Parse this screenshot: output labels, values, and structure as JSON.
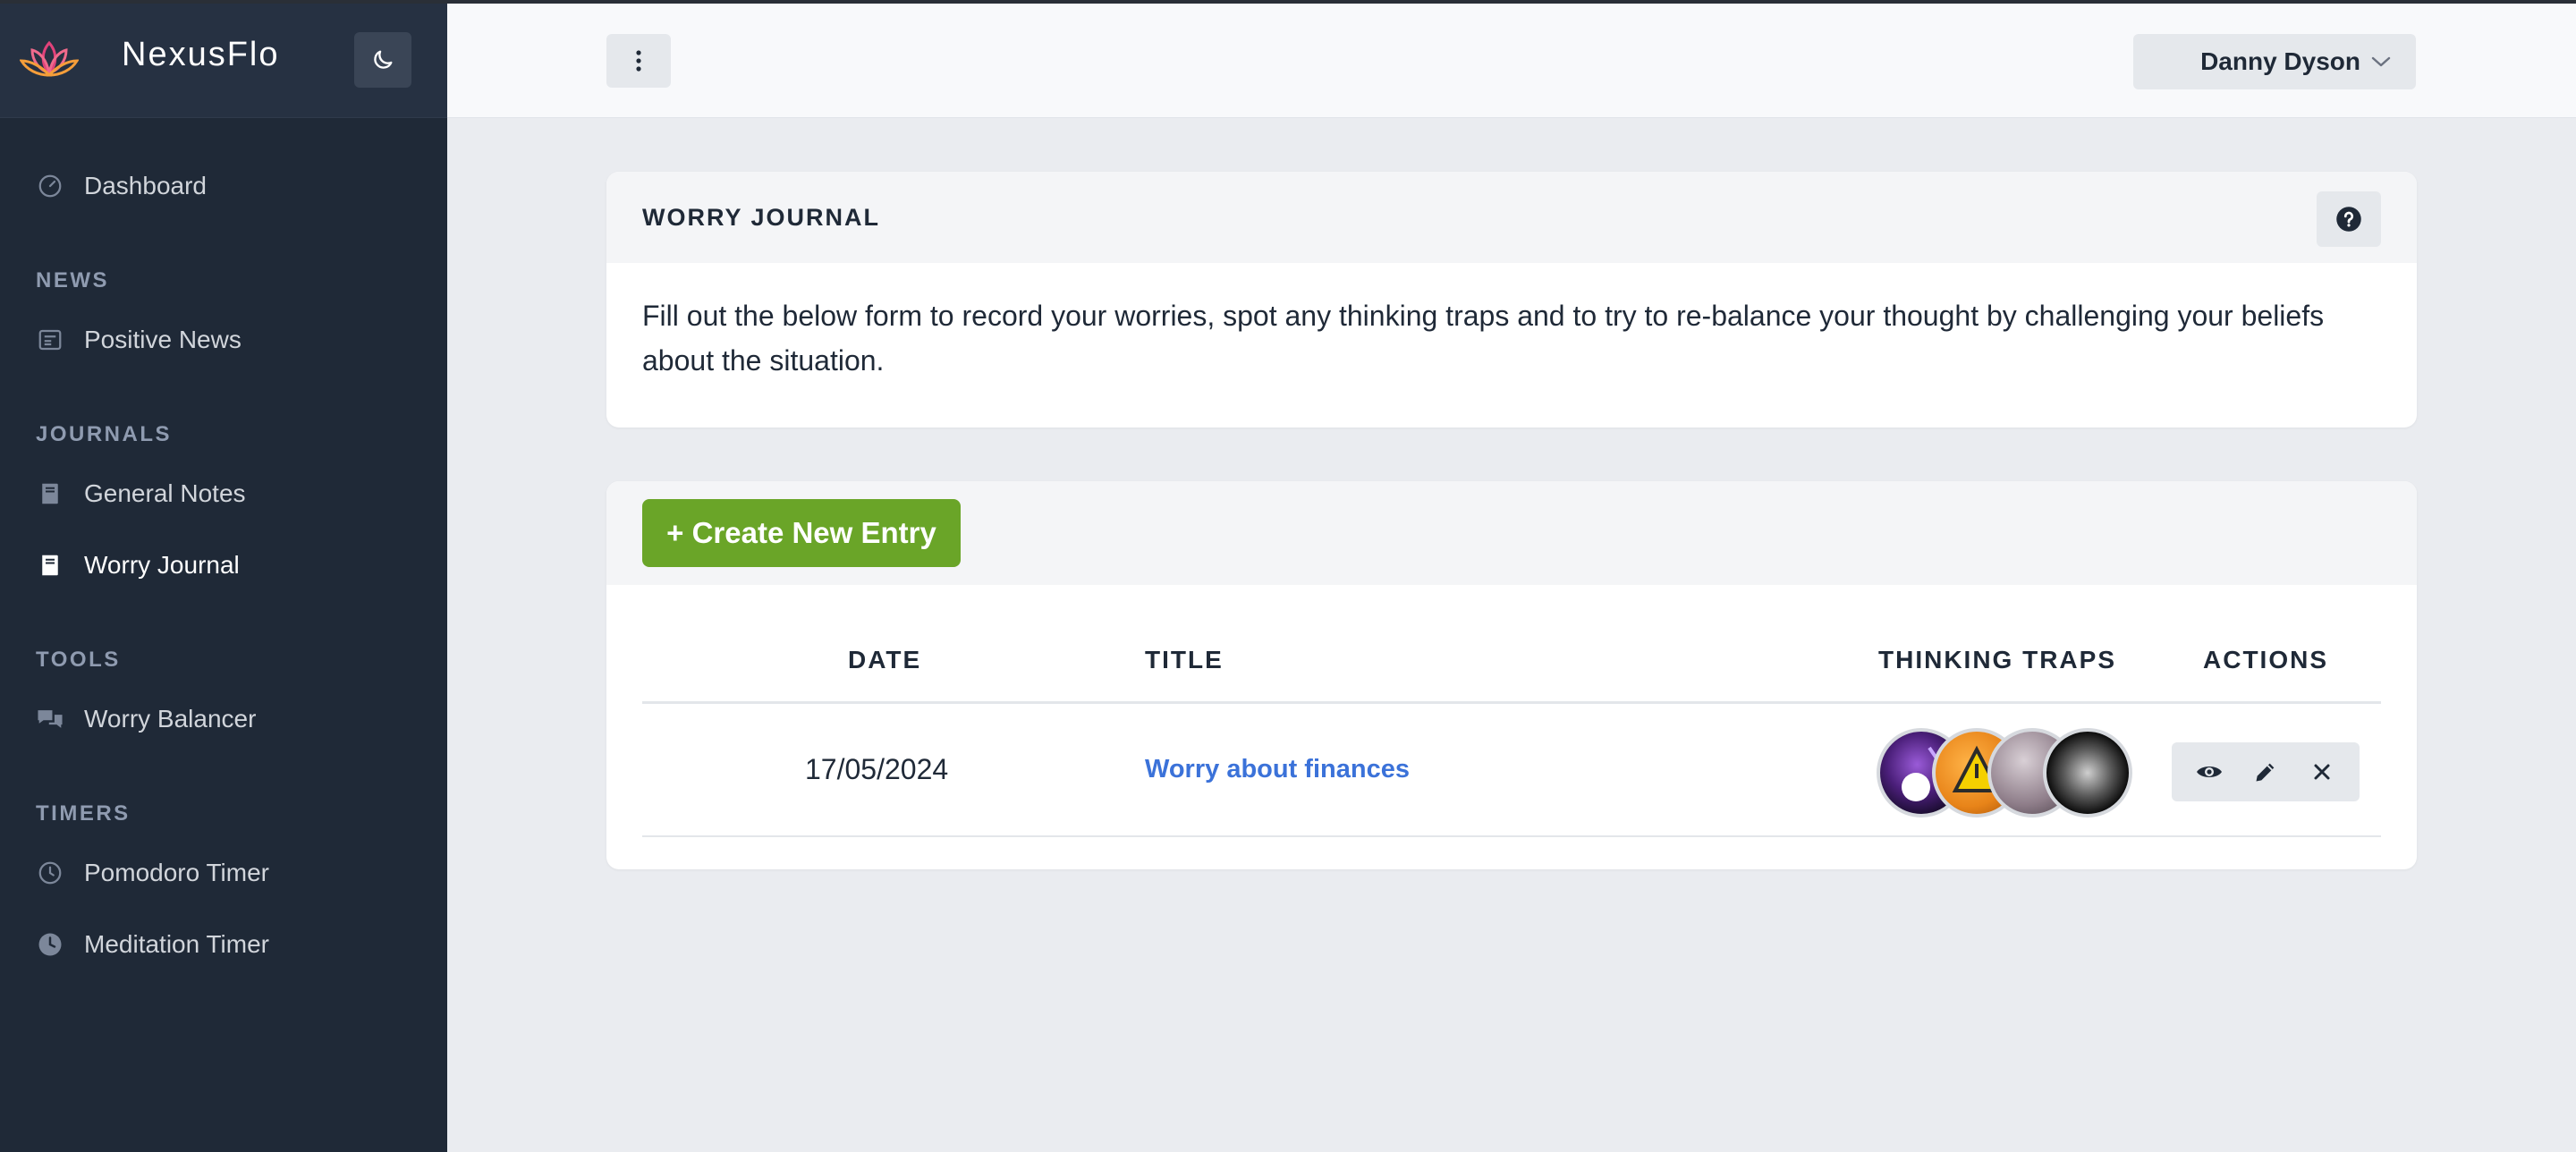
{
  "app": {
    "brand": "NexusFlo"
  },
  "sidebar": {
    "dashboard": "Dashboard",
    "sections": {
      "news": "NEWS",
      "journals": "JOURNALS",
      "tools": "TOOLS",
      "timers": "TIMERS"
    },
    "items": {
      "positive_news": "Positive News",
      "general_notes": "General Notes",
      "worry_journal": "Worry Journal",
      "worry_balancer": "Worry Balancer",
      "pomodoro_timer": "Pomodoro Timer",
      "meditation_timer": "Meditation Timer"
    },
    "active": "worry_journal"
  },
  "header": {
    "user_name": "Danny Dyson"
  },
  "intro": {
    "title": "WORRY JOURNAL",
    "text": "Fill out the below form to record your worries, spot any thinking traps and to try to re-balance your thought by challenging your beliefs about the situation."
  },
  "entries": {
    "create_label": "+ Create New Entry",
    "columns": {
      "date": "DATE",
      "title": "TITLE",
      "traps": "THINKING TRAPS",
      "actions": "ACTIONS"
    },
    "rows": [
      {
        "date": "17/05/2024",
        "title": "Worry about finances"
      }
    ]
  },
  "colors": {
    "sidebar_bg": "#1f2937",
    "accent_green": "#6aa528",
    "link_blue": "#3b72d9"
  },
  "icons": {
    "logo": "lotus-logo-icon",
    "theme": "moon-icon",
    "menu": "kebab-icon",
    "dropdown": "chevron-down-icon",
    "help": "question-icon",
    "view": "eye-icon",
    "edit": "pencil-icon",
    "delete": "close-icon"
  }
}
